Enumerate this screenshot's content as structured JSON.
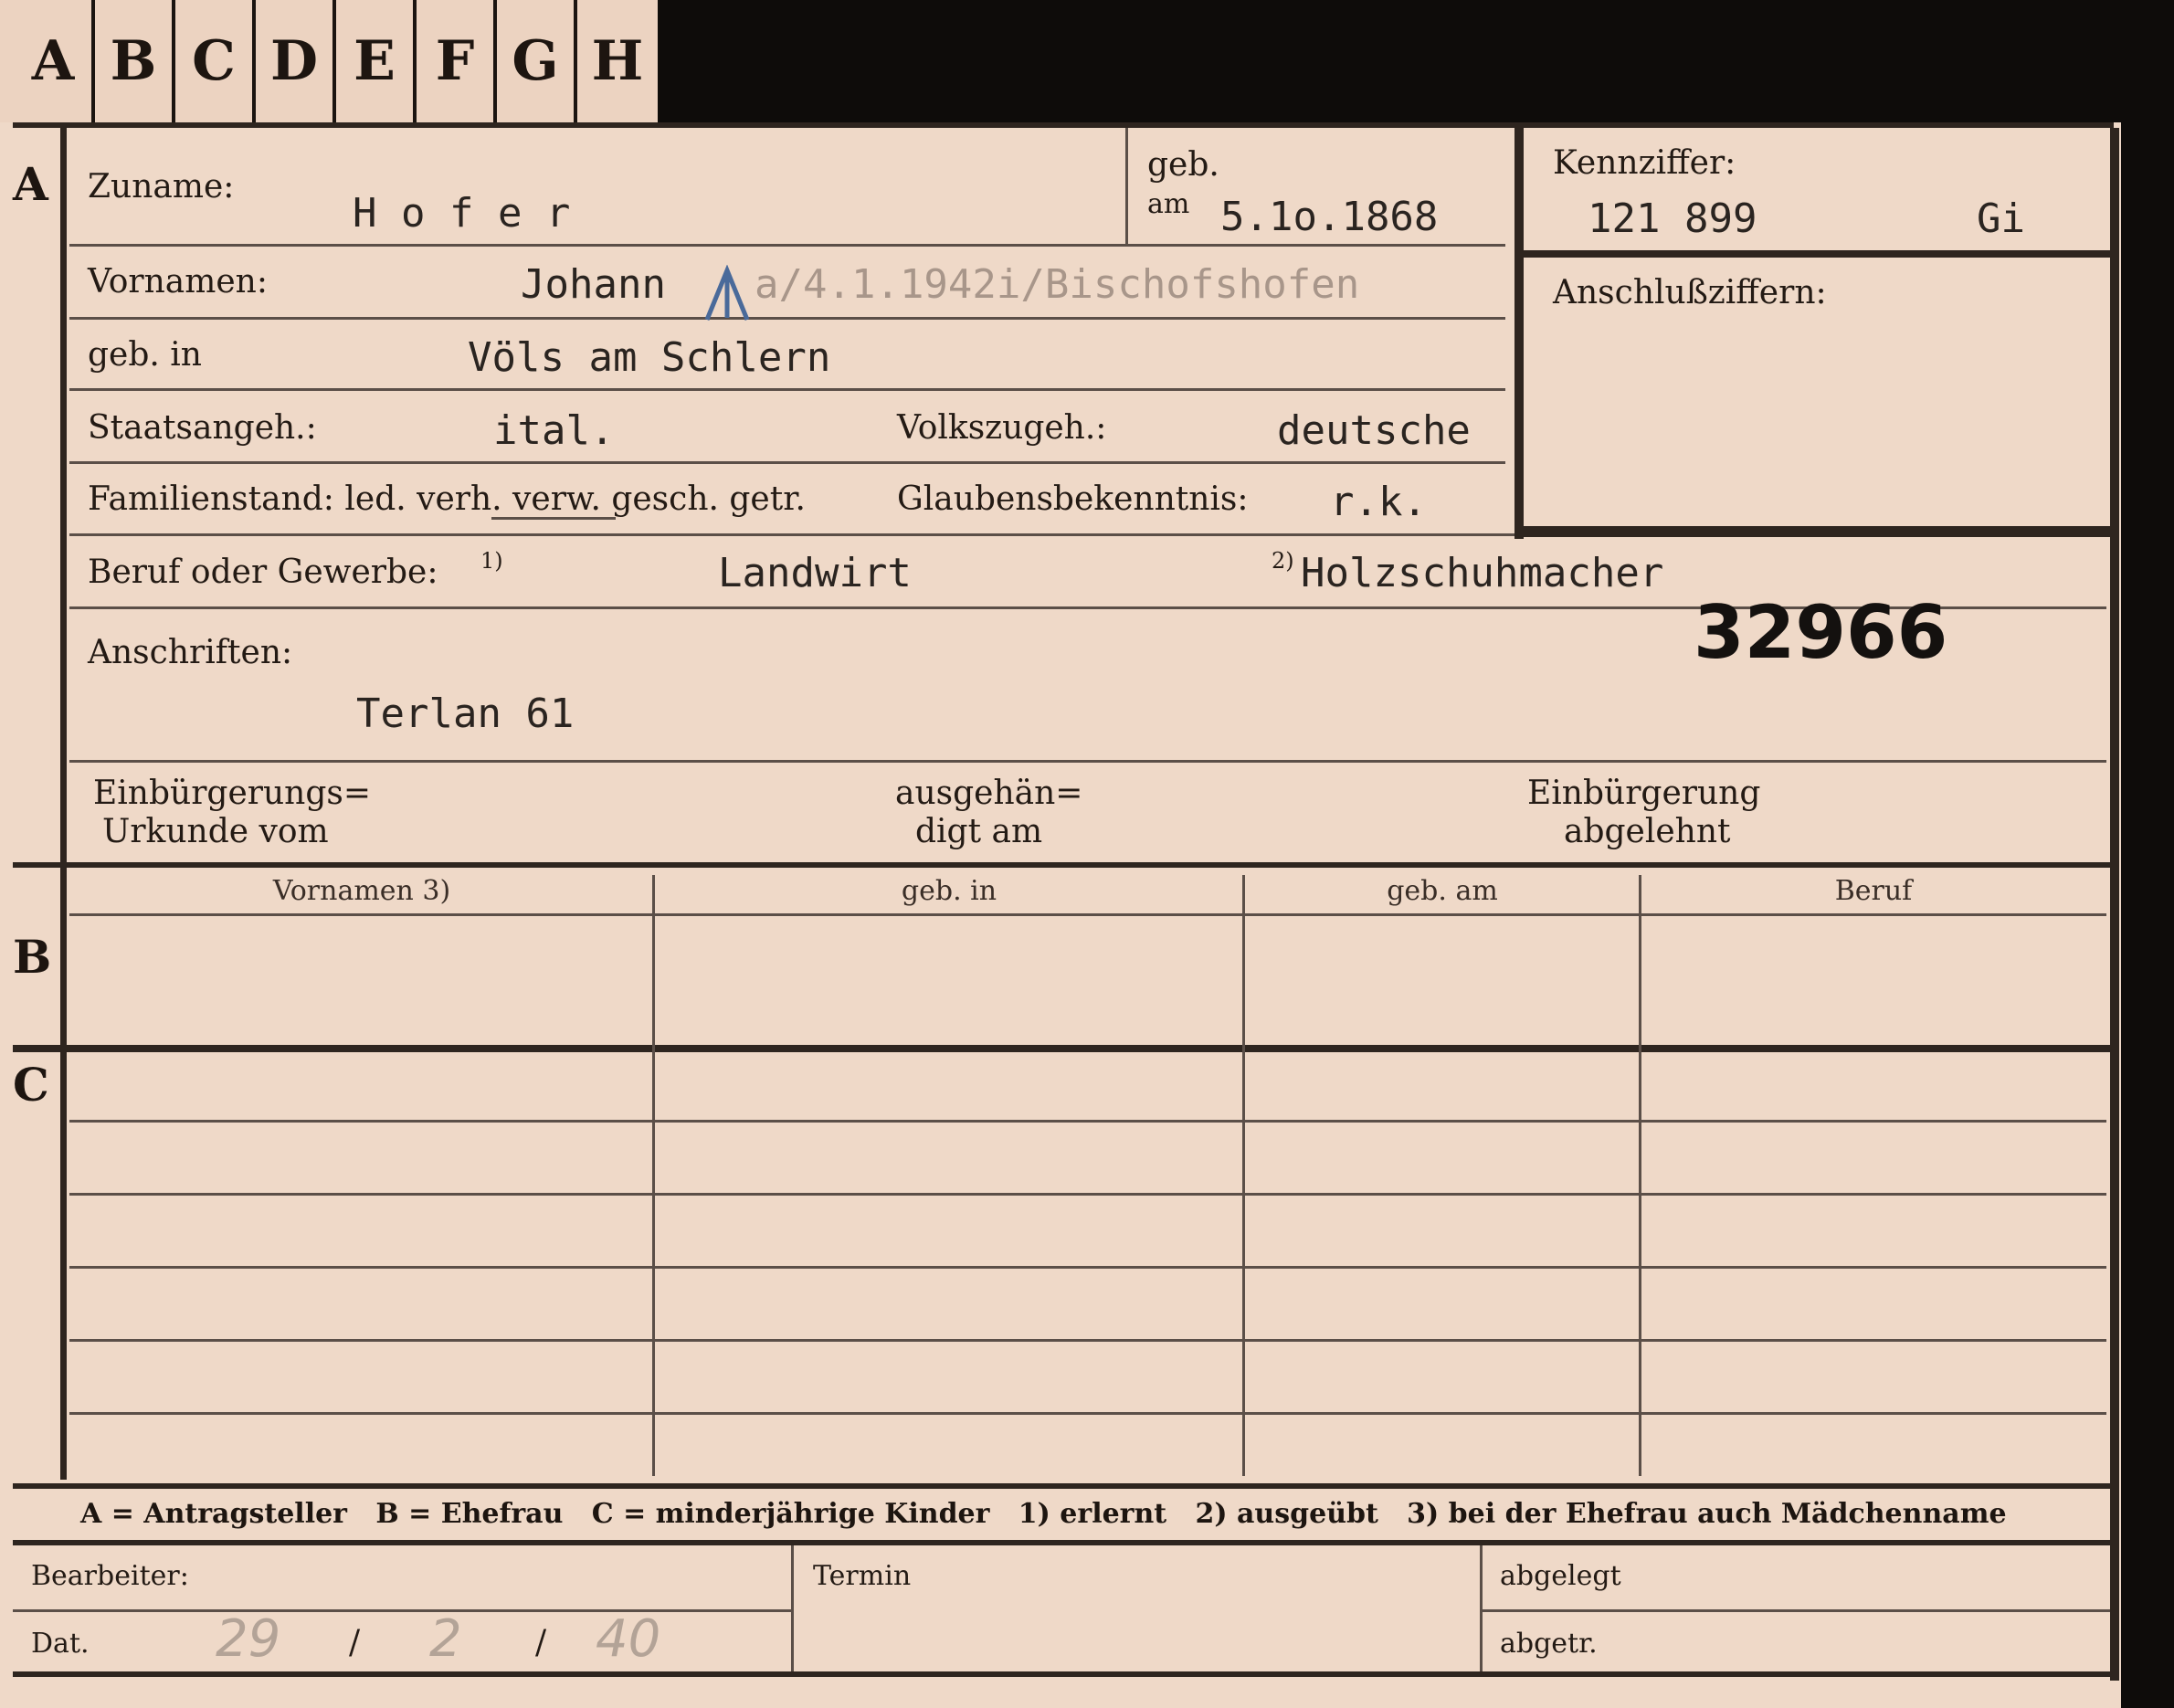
{
  "tabs": [
    "A",
    "B",
    "C",
    "D",
    "E",
    "F",
    "G",
    "H"
  ],
  "sections": {
    "a": "A",
    "b": "B",
    "c": "C"
  },
  "labels": {
    "zuname": "Zuname:",
    "geb": "geb.",
    "am": "am",
    "kennziffer": "Kennziffer:",
    "vornamen": "Vornamen:",
    "anschlussziffern": "Anschlußziffern:",
    "geb_in": "geb. in",
    "staatsangeh": "Staatsangeh.:",
    "volkszugeh": "Volkszugeh.:",
    "familienstand": "Familienstand: led. verh. verw. gesch. getr.",
    "glaubensbekenntnis": "Glaubensbekenntnis:",
    "beruf": "Beruf oder Gewerbe:",
    "beruf_note1": "1)",
    "beruf_note2": "2)",
    "anschriften": "Anschriften:",
    "einb_1": "Einbürgerungs=",
    "einb_2": "Urkunde vom",
    "ausg_1": "ausgehän=",
    "ausg_2": "digt am",
    "abgel_1": "Einbürgerung",
    "abgel_2": "abgelehnt"
  },
  "values": {
    "zuname": "H o f e r",
    "geb_am": "5.1o.1868",
    "kennziffer": "121 899",
    "kennziffer_suffix": "Gi",
    "vornamen": "Johann",
    "vornamen_note": "a/4.1.1942i/Bischofshofen",
    "geb_in": "Völs am Schlern",
    "staatsangeh": "ital.",
    "volkszugeh": "deutsche",
    "glaubensbekenntnis": "r.k.",
    "beruf1": "Landwirt",
    "beruf2": "Holzschuhmacher",
    "stamp_number": "32966",
    "anschrift": "Terlan 61"
  },
  "table": {
    "headers": [
      "Vornamen 3)",
      "geb. in",
      "geb. am",
      "Beruf"
    ]
  },
  "legend": "A = Antragsteller   B = Ehefrau   C = minderjährige Kinder   1) erlernt   2) ausgeübt   3) bei der Ehefrau auch Mädchenname",
  "footer": {
    "bearbeiter": "Bearbeiter:",
    "termin": "Termin",
    "abgelegt": "abgelegt",
    "dat": "Dat.",
    "abgetr": "abgetr.",
    "date_day": "29",
    "date_month": "2",
    "date_year": "40",
    "date_sep": "/"
  }
}
